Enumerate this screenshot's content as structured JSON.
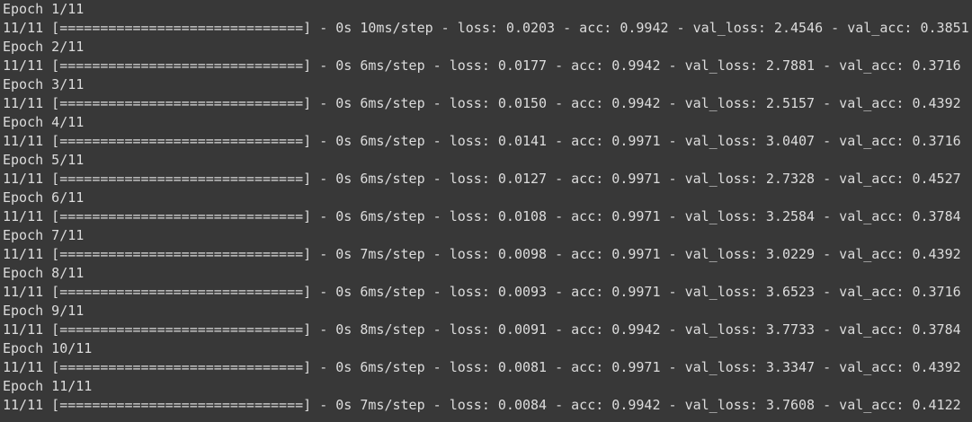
{
  "terminal": {
    "lines": [
      "Epoch 1/11",
      "11/11 [==============================] - 0s 10ms/step - loss: 0.0203 - acc: 0.9942 - val_loss: 2.4546 - val_acc: 0.3851",
      "Epoch 2/11",
      "11/11 [==============================] - 0s 6ms/step - loss: 0.0177 - acc: 0.9942 - val_loss: 2.7881 - val_acc: 0.3716",
      "Epoch 3/11",
      "11/11 [==============================] - 0s 6ms/step - loss: 0.0150 - acc: 0.9942 - val_loss: 2.5157 - val_acc: 0.4392",
      "Epoch 4/11",
      "11/11 [==============================] - 0s 6ms/step - loss: 0.0141 - acc: 0.9971 - val_loss: 3.0407 - val_acc: 0.3716",
      "Epoch 5/11",
      "11/11 [==============================] - 0s 6ms/step - loss: 0.0127 - acc: 0.9971 - val_loss: 2.7328 - val_acc: 0.4527",
      "Epoch 6/11",
      "11/11 [==============================] - 0s 6ms/step - loss: 0.0108 - acc: 0.9971 - val_loss: 3.2584 - val_acc: 0.3784",
      "Epoch 7/11",
      "11/11 [==============================] - 0s 7ms/step - loss: 0.0098 - acc: 0.9971 - val_loss: 3.0229 - val_acc: 0.4392",
      "Epoch 8/11",
      "11/11 [==============================] - 0s 6ms/step - loss: 0.0093 - acc: 0.9971 - val_loss: 3.6523 - val_acc: 0.3716",
      "Epoch 9/11",
      "11/11 [==============================] - 0s 8ms/step - loss: 0.0091 - acc: 0.9942 - val_loss: 3.7733 - val_acc: 0.3784",
      "Epoch 10/11",
      "11/11 [==============================] - 0s 6ms/step - loss: 0.0081 - acc: 0.9971 - val_loss: 3.3347 - val_acc: 0.4392",
      "Epoch 11/11",
      "11/11 [==============================] - 0s 7ms/step - loss: 0.0084 - acc: 0.9942 - val_loss: 3.7608 - val_acc: 0.4122"
    ]
  },
  "colors": {
    "background": "#383838",
    "text": "#dcdcdc"
  }
}
